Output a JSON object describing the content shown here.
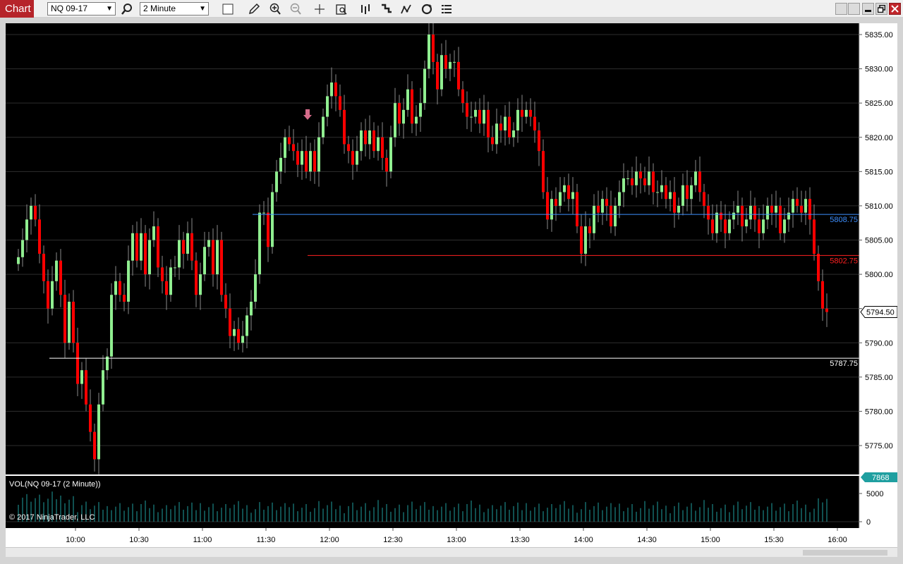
{
  "toolbar": {
    "tab_label": "Chart",
    "instrument": "NQ 09-17",
    "interval": "2 Minute"
  },
  "icons": [
    "search-icon",
    "square-icon",
    "pencil-icon",
    "zoom-in-icon",
    "zoom-out-icon",
    "crosshair-icon",
    "data-box-icon",
    "bars-icon",
    "strategies-icon",
    "indicators-icon",
    "refresh-icon",
    "properties-icon"
  ],
  "window_buttons": [
    "minimize-icon",
    "maximize-icon",
    "close-icon"
  ],
  "price_panel": {
    "last_price": "5794.50",
    "hlines": [
      {
        "price": 5808.75,
        "label": "5808.75",
        "color": "#3d8fff"
      },
      {
        "price": 5802.75,
        "label": "5802.75",
        "color": "#ff2020"
      },
      {
        "price": 5787.75,
        "label": "5787.75",
        "color": "#ffffff"
      }
    ],
    "y_ticks": [
      "5835.00",
      "5830.00",
      "5825.00",
      "5820.00",
      "5815.00",
      "5810.00",
      "5805.00",
      "5800.00",
      "5795.00",
      "5790.00",
      "5785.00",
      "5780.00",
      "5775.00"
    ]
  },
  "volume_panel": {
    "title": "VOL(NQ 09-17 (2 Minute))",
    "last_volume": "7868",
    "y_ticks": [
      "5000",
      "0"
    ],
    "copyright": "© 2017 NinjaTrader, LLC"
  },
  "x_ticks": [
    "10:00",
    "10:30",
    "11:00",
    "11:30",
    "12:00",
    "12:30",
    "13:00",
    "13:30",
    "14:00",
    "14:30",
    "15:00",
    "15:30",
    "16:00"
  ],
  "colors": {
    "up": "#90ee90",
    "down": "#ff0000",
    "volume": "#1f9fa0",
    "accent": "#b6242a"
  },
  "chart_data": {
    "type": "candlestick",
    "instrument": "NQ 09-17",
    "interval": "2 Minute",
    "ylim": [
      5771,
      5838
    ],
    "time_range": [
      "09:30",
      "16:00"
    ],
    "close_series": [
      [
        "09:33",
        5802.5
      ],
      [
        "09:35",
        5805
      ],
      [
        "09:37",
        5808
      ],
      [
        "09:39",
        5810
      ],
      [
        "09:41",
        5808
      ],
      [
        "09:43",
        5803
      ],
      [
        "09:45",
        5799
      ],
      [
        "09:47",
        5795
      ],
      [
        "09:49",
        5799
      ],
      [
        "09:51",
        5802
      ],
      [
        "09:53",
        5797
      ],
      [
        "09:55",
        5790
      ],
      [
        "09:57",
        5796
      ],
      [
        "09:59",
        5790
      ],
      [
        "10:01",
        5784
      ],
      [
        "10:03",
        5786
      ],
      [
        "10:05",
        5781
      ],
      [
        "10:07",
        5777
      ],
      [
        "10:09",
        5773
      ],
      [
        "10:11",
        5781
      ],
      [
        "10:13",
        5786
      ],
      [
        "10:15",
        5788
      ],
      [
        "10:17",
        5797
      ],
      [
        "10:19",
        5799
      ],
      [
        "10:21",
        5797
      ],
      [
        "10:23",
        5796
      ],
      [
        "10:25",
        5802
      ],
      [
        "10:27",
        5806
      ],
      [
        "10:29",
        5802
      ],
      [
        "10:31",
        5806
      ],
      [
        "10:33",
        5800
      ],
      [
        "10:35",
        5805
      ],
      [
        "10:37",
        5807
      ],
      [
        "10:39",
        5801
      ],
      [
        "10:41",
        5799
      ],
      [
        "10:43",
        5797
      ],
      [
        "10:45",
        5801
      ],
      [
        "10:47",
        5801
      ],
      [
        "10:49",
        5805
      ],
      [
        "10:51",
        5803
      ],
      [
        "10:53",
        5806
      ],
      [
        "10:55",
        5802
      ],
      [
        "10:57",
        5797
      ],
      [
        "10:59",
        5800
      ],
      [
        "11:01",
        5804
      ],
      [
        "11:03",
        5805
      ],
      [
        "11:05",
        5800
      ],
      [
        "11:07",
        5805
      ],
      [
        "11:09",
        5797
      ],
      [
        "11:11",
        5795
      ],
      [
        "11:13",
        5791
      ],
      [
        "11:15",
        5792
      ],
      [
        "11:17",
        5790
      ],
      [
        "11:19",
        5791
      ],
      [
        "11:21",
        5794
      ],
      [
        "11:23",
        5796
      ],
      [
        "11:25",
        5800
      ],
      [
        "11:27",
        5809
      ],
      [
        "11:29",
        5809
      ],
      [
        "11:31",
        5804
      ],
      [
        "11:33",
        5812
      ],
      [
        "11:35",
        5815
      ],
      [
        "11:37",
        5817
      ],
      [
        "11:39",
        5820
      ],
      [
        "11:41",
        5819
      ],
      [
        "11:43",
        5818
      ],
      [
        "11:45",
        5816
      ],
      [
        "11:47",
        5818
      ],
      [
        "11:49",
        5815
      ],
      [
        "11:51",
        5818
      ],
      [
        "11:53",
        5815
      ],
      [
        "11:55",
        5820
      ],
      [
        "11:57",
        5823
      ],
      [
        "11:59",
        5826
      ],
      [
        "12:01",
        5828
      ],
      [
        "12:03",
        5826
      ],
      [
        "12:05",
        5824
      ],
      [
        "12:07",
        5819
      ],
      [
        "12:09",
        5818
      ],
      [
        "12:11",
        5816
      ],
      [
        "12:13",
        5818
      ],
      [
        "12:15",
        5821
      ],
      [
        "12:17",
        5819
      ],
      [
        "12:19",
        5821
      ],
      [
        "12:21",
        5818
      ],
      [
        "12:23",
        5820
      ],
      [
        "12:25",
        5817
      ],
      [
        "12:27",
        5815
      ],
      [
        "12:29",
        5820
      ],
      [
        "12:31",
        5825
      ],
      [
        "12:33",
        5822
      ],
      [
        "12:35",
        5824
      ],
      [
        "12:37",
        5827
      ],
      [
        "12:39",
        5822
      ],
      [
        "12:41",
        5823
      ],
      [
        "12:43",
        5825
      ],
      [
        "12:45",
        5830
      ],
      [
        "12:47",
        5835
      ],
      [
        "12:49",
        5831
      ],
      [
        "12:51",
        5827
      ],
      [
        "12:53",
        5832
      ],
      [
        "12:55",
        5830
      ],
      [
        "12:57",
        5831
      ],
      [
        "12:59",
        5831
      ],
      [
        "13:01",
        5827
      ],
      [
        "13:03",
        5825
      ],
      [
        "13:05",
        5823
      ],
      [
        "13:07",
        5823
      ],
      [
        "13:09",
        5824
      ],
      [
        "13:11",
        5822
      ],
      [
        "13:13",
        5824
      ],
      [
        "13:15",
        5820
      ],
      [
        "13:17",
        5819
      ],
      [
        "13:19",
        5822
      ],
      [
        "13:21",
        5821
      ],
      [
        "13:23",
        5823
      ],
      [
        "13:25",
        5820
      ],
      [
        "13:27",
        5821
      ],
      [
        "13:29",
        5824
      ],
      [
        "13:31",
        5823
      ],
      [
        "13:33",
        5824
      ],
      [
        "13:35",
        5823
      ],
      [
        "13:37",
        5821
      ],
      [
        "13:39",
        5818
      ],
      [
        "13:41",
        5812
      ],
      [
        "13:43",
        5808
      ],
      [
        "13:45",
        5811
      ],
      [
        "13:47",
        5810
      ],
      [
        "13:49",
        5812
      ],
      [
        "13:51",
        5813
      ],
      [
        "13:53",
        5811
      ],
      [
        "13:55",
        5812
      ],
      [
        "13:57",
        5807
      ],
      [
        "13:59",
        5803
      ],
      [
        "14:01",
        5807
      ],
      [
        "14:03",
        5806
      ],
      [
        "14:05",
        5810
      ],
      [
        "14:07",
        5809
      ],
      [
        "14:09",
        5811
      ],
      [
        "14:11",
        5810
      ],
      [
        "14:13",
        5807
      ],
      [
        "14:15",
        5810
      ],
      [
        "14:17",
        5812
      ],
      [
        "14:19",
        5814
      ],
      [
        "14:21",
        5814
      ],
      [
        "14:23",
        5813
      ],
      [
        "14:25",
        5815
      ],
      [
        "14:27",
        5814
      ],
      [
        "14:29",
        5813
      ],
      [
        "14:31",
        5815
      ],
      [
        "14:33",
        5812
      ],
      [
        "14:35",
        5812
      ],
      [
        "14:37",
        5813
      ],
      [
        "14:39",
        5811
      ],
      [
        "14:41",
        5812
      ],
      [
        "14:43",
        5809
      ],
      [
        "14:45",
        5810
      ],
      [
        "14:47",
        5813
      ],
      [
        "14:49",
        5811
      ],
      [
        "14:51",
        5813
      ],
      [
        "14:53",
        5815
      ],
      [
        "14:55",
        5812
      ],
      [
        "14:57",
        5810
      ],
      [
        "14:59",
        5808
      ],
      [
        "15:01",
        5806
      ],
      [
        "15:03",
        5809
      ],
      [
        "15:05",
        5808
      ],
      [
        "15:07",
        5806
      ],
      [
        "15:09",
        5808
      ],
      [
        "15:11",
        5809
      ],
      [
        "15:13",
        5810
      ],
      [
        "15:15",
        5807
      ],
      [
        "15:17",
        5808
      ],
      [
        "15:19",
        5810
      ],
      [
        "15:21",
        5808
      ],
      [
        "15:23",
        5806
      ],
      [
        "15:25",
        5808
      ],
      [
        "15:27",
        5810
      ],
      [
        "15:29",
        5809
      ],
      [
        "15:31",
        5810
      ],
      [
        "15:33",
        5806
      ],
      [
        "15:35",
        5808
      ],
      [
        "15:37",
        5809
      ],
      [
        "15:39",
        5811
      ],
      [
        "15:41",
        5810
      ],
      [
        "15:43",
        5809
      ],
      [
        "15:45",
        5811
      ],
      [
        "15:47",
        5808
      ],
      [
        "15:49",
        5803
      ],
      [
        "15:51",
        5799
      ],
      [
        "15:53",
        5795
      ],
      [
        "15:55",
        5794.5
      ]
    ]
  }
}
